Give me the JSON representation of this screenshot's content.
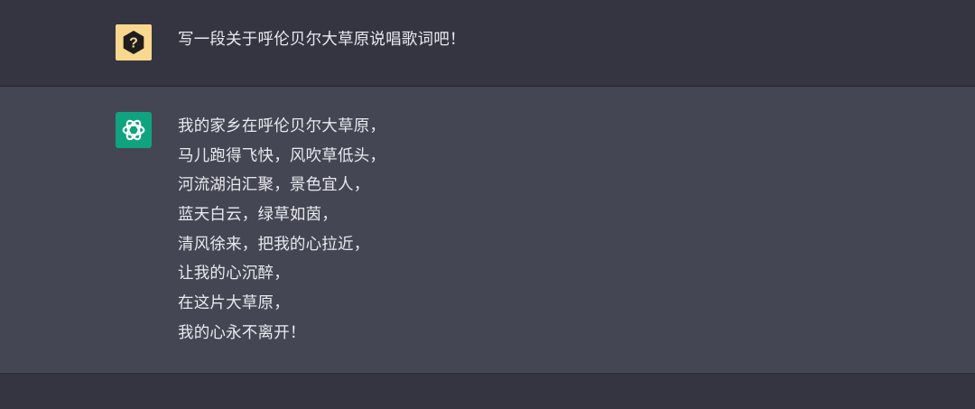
{
  "conversation": {
    "user_message": {
      "avatar": "question-mark-badge-icon",
      "text": "写一段关于呼伦贝尔大草原说唱歌词吧！"
    },
    "assistant_message": {
      "avatar": "openai-logo-icon",
      "lines": [
        "我的家乡在呼伦贝尔大草原，",
        "马儿跑得飞快，风吹草低头，",
        "河流湖泊汇聚，景色宜人，",
        "蓝天白云，绿草如茵，",
        "清风徐来，把我的心拉近，",
        "让我的心沉醉，",
        "在这片大草原，",
        "我的心永不离开！"
      ]
    }
  },
  "colors": {
    "page_background": "#343541",
    "assistant_background": "#444654",
    "user_avatar": "#f8d78f",
    "assistant_avatar": "#10a37f",
    "text": "#e9e9ee"
  }
}
